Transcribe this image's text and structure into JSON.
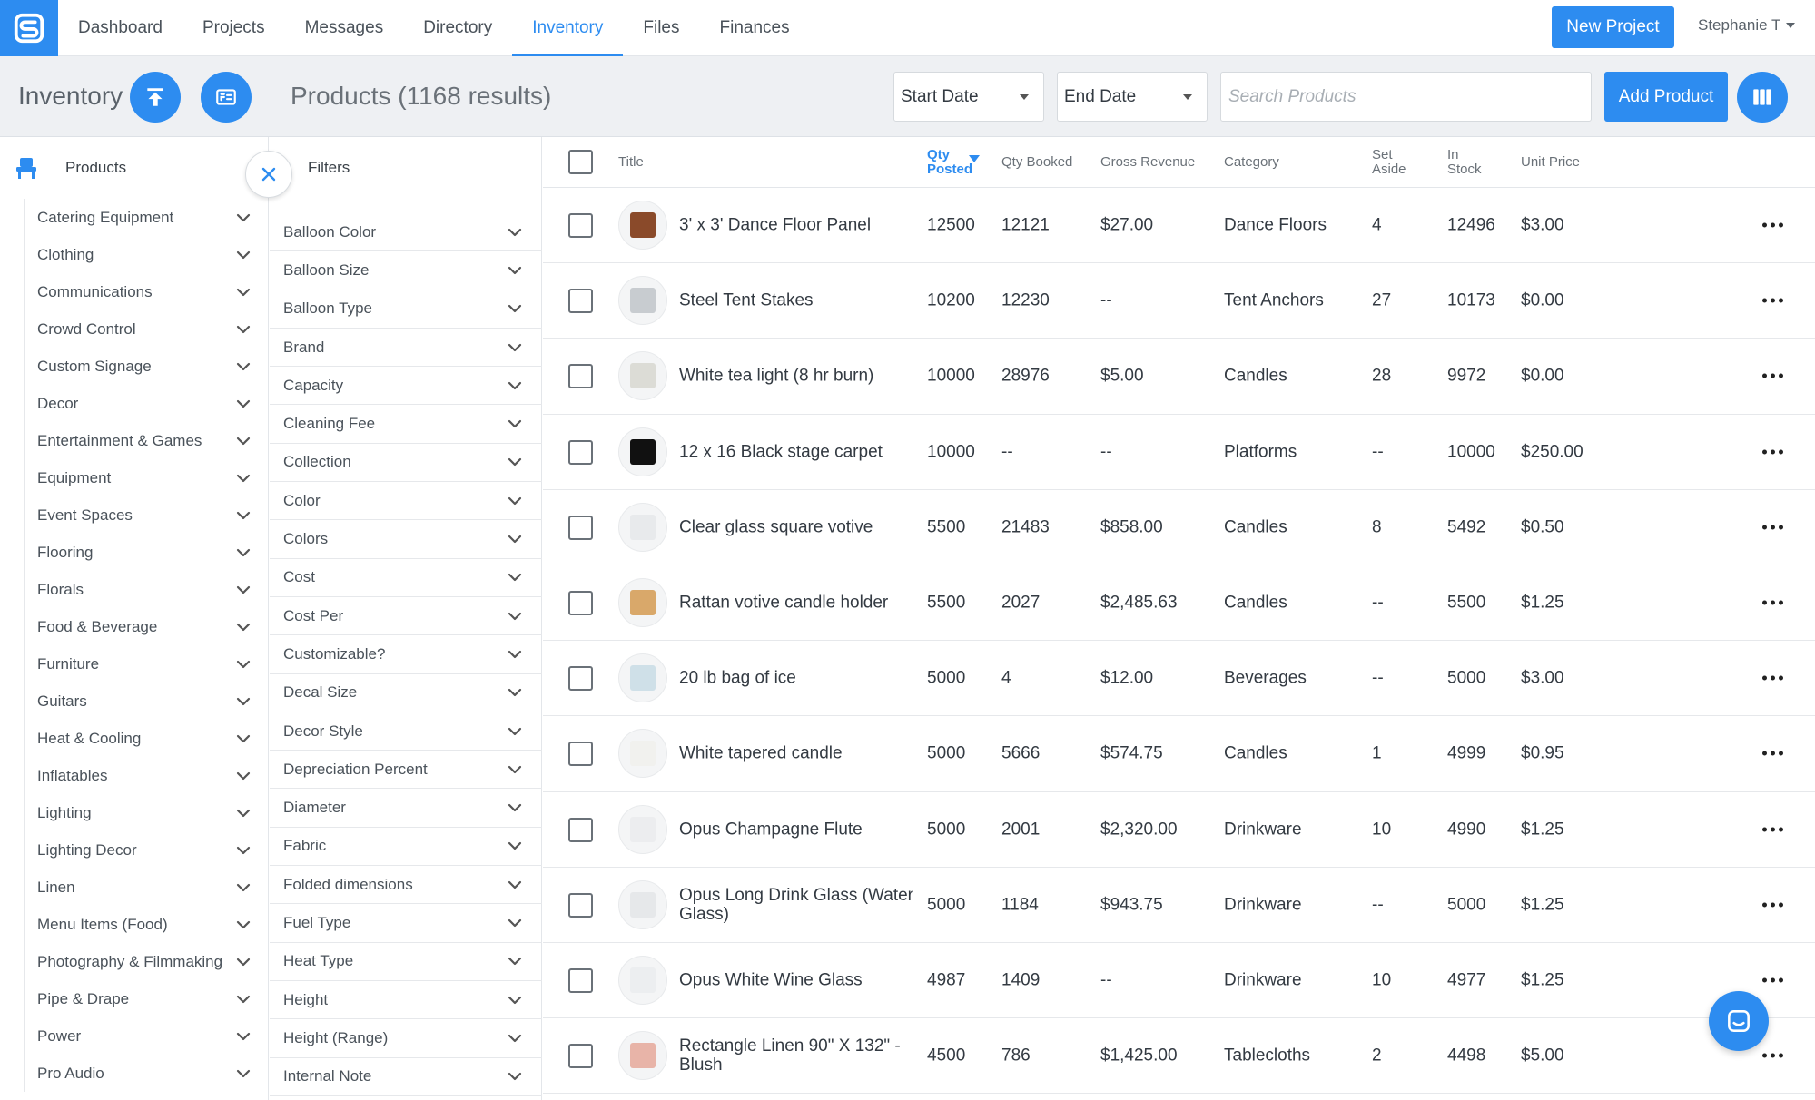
{
  "nav": {
    "items": [
      {
        "label": "Dashboard",
        "active": false
      },
      {
        "label": "Projects",
        "active": false
      },
      {
        "label": "Messages",
        "active": false
      },
      {
        "label": "Directory",
        "active": false
      },
      {
        "label": "Inventory",
        "active": true
      },
      {
        "label": "Files",
        "active": false
      },
      {
        "label": "Finances",
        "active": false
      }
    ],
    "new_project_label": "New Project",
    "user_name": "Stephanie T"
  },
  "subheader": {
    "title": "Inventory",
    "results_title": "Products (1168 results)",
    "start_date_label": "Start Date",
    "end_date_label": "End Date",
    "search_placeholder": "Search Products",
    "add_product_label": "Add Product"
  },
  "categories": {
    "heading": "Products",
    "items": [
      "Catering Equipment",
      "Clothing",
      "Communications",
      "Crowd Control",
      "Custom Signage",
      "Decor",
      "Entertainment & Games",
      "Equipment",
      "Event Spaces",
      "Flooring",
      "Florals",
      "Food & Beverage",
      "Furniture",
      "Guitars",
      "Heat & Cooling",
      "Inflatables",
      "Lighting",
      "Lighting Decor",
      "Linen",
      "Menu Items (Food)",
      "Photography & Filmmaking",
      "Pipe & Drape",
      "Power",
      "Pro Audio"
    ]
  },
  "filters": {
    "heading": "Filters",
    "items": [
      "Balloon Color",
      "Balloon Size",
      "Balloon Type",
      "Brand",
      "Capacity",
      "Cleaning Fee",
      "Collection",
      "Color",
      "Colors",
      "Cost",
      "Cost Per",
      "Customizable?",
      "Decal Size",
      "Decor Style",
      "Depreciation Percent",
      "Diameter",
      "Fabric",
      "Folded dimensions",
      "Fuel Type",
      "Heat Type",
      "Height",
      "Height (Range)",
      "Internal Note"
    ]
  },
  "table": {
    "columns": {
      "title": "Title",
      "qty_posted": "Qty\nPosted",
      "qty_booked": "Qty Booked",
      "gross_revenue": "Gross Revenue",
      "category": "Category",
      "set_aside": "Set\nAside",
      "in_stock": "In\nStock",
      "unit_price": "Unit Price"
    },
    "rows": [
      {
        "title": "3' x 3' Dance Floor Panel",
        "qty_posted": "12500",
        "qty_booked": "12121",
        "gross_revenue": "$27.00",
        "category": "Dance Floors",
        "set_aside": "4",
        "in_stock": "12496",
        "unit_price": "$3.00",
        "thumb_color": "#8a4a2a"
      },
      {
        "title": "Steel Tent Stakes",
        "qty_posted": "10200",
        "qty_booked": "12230",
        "gross_revenue": "--",
        "category": "Tent Anchors",
        "set_aside": "27",
        "in_stock": "10173",
        "unit_price": "$0.00",
        "thumb_color": "#c8ccd0"
      },
      {
        "title": "White tea light (8 hr burn)",
        "qty_posted": "10000",
        "qty_booked": "28976",
        "gross_revenue": "$5.00",
        "category": "Candles",
        "set_aside": "28",
        "in_stock": "9972",
        "unit_price": "$0.00",
        "thumb_color": "#dcdcd6"
      },
      {
        "title": "12 x 16 Black stage carpet",
        "qty_posted": "10000",
        "qty_booked": "--",
        "gross_revenue": "--",
        "category": "Platforms",
        "set_aside": "--",
        "in_stock": "10000",
        "unit_price": "$250.00",
        "thumb_color": "#111111"
      },
      {
        "title": "Clear glass square votive",
        "qty_posted": "5500",
        "qty_booked": "21483",
        "gross_revenue": "$858.00",
        "category": "Candles",
        "set_aside": "8",
        "in_stock": "5492",
        "unit_price": "$0.50",
        "thumb_color": "#e8eaec"
      },
      {
        "title": "Rattan votive candle holder",
        "qty_posted": "5500",
        "qty_booked": "2027",
        "gross_revenue": "$2,485.63",
        "category": "Candles",
        "set_aside": "--",
        "in_stock": "5500",
        "unit_price": "$1.25",
        "thumb_color": "#d9a86a"
      },
      {
        "title": "20 lb bag of ice",
        "qty_posted": "5000",
        "qty_booked": "4",
        "gross_revenue": "$12.00",
        "category": "Beverages",
        "set_aside": "--",
        "in_stock": "5000",
        "unit_price": "$3.00",
        "thumb_color": "#cfe0e8"
      },
      {
        "title": "White tapered candle",
        "qty_posted": "5000",
        "qty_booked": "5666",
        "gross_revenue": "$574.75",
        "category": "Candles",
        "set_aside": "1",
        "in_stock": "4999",
        "unit_price": "$0.95",
        "thumb_color": "#f1f1ee"
      },
      {
        "title": "Opus Champagne Flute",
        "qty_posted": "5000",
        "qty_booked": "2001",
        "gross_revenue": "$2,320.00",
        "category": "Drinkware",
        "set_aside": "10",
        "in_stock": "4990",
        "unit_price": "$1.25",
        "thumb_color": "#ecedef"
      },
      {
        "title": "Opus Long Drink Glass (Water Glass)",
        "qty_posted": "5000",
        "qty_booked": "1184",
        "gross_revenue": "$943.75",
        "category": "Drinkware",
        "set_aside": "--",
        "in_stock": "5000",
        "unit_price": "$1.25",
        "thumb_color": "#e6e8ea"
      },
      {
        "title": "Opus White Wine Glass",
        "qty_posted": "4987",
        "qty_booked": "1409",
        "gross_revenue": "--",
        "category": "Drinkware",
        "set_aside": "10",
        "in_stock": "4977",
        "unit_price": "$1.25",
        "thumb_color": "#eceef0"
      },
      {
        "title": "Rectangle Linen 90\" X 132\" - Blush",
        "qty_posted": "4500",
        "qty_booked": "786",
        "gross_revenue": "$1,425.00",
        "category": "Tablecloths",
        "set_aside": "2",
        "in_stock": "4498",
        "unit_price": "$5.00",
        "thumb_color": "#e8b4a8"
      }
    ]
  },
  "colors": {
    "accent": "#2d8cf0",
    "header_bg": "#eef0f3"
  },
  "icons": {
    "logo": "logo-s-icon",
    "upload": "upload-icon",
    "barcode_card": "id-card-icon",
    "columns": "columns-icon",
    "products_category": "chair-icon",
    "close": "close-icon",
    "chat": "chat-icon",
    "row_menu": "more-horizontal-icon"
  }
}
